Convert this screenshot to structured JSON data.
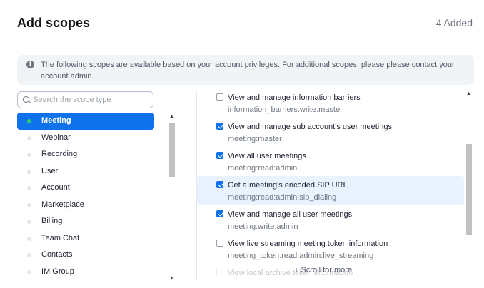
{
  "header": {
    "title": "Add scopes",
    "added_count": "4 Added"
  },
  "notice": {
    "icon": "info-icon",
    "text": "The following scopes are available based on your account privileges. For additional scopes, please please contact your account admin."
  },
  "search": {
    "placeholder": "Search the scope type",
    "value": ""
  },
  "categories": [
    {
      "label": "Meeting",
      "active": true
    },
    {
      "label": "Webinar",
      "active": false
    },
    {
      "label": "Recording",
      "active": false
    },
    {
      "label": "User",
      "active": false
    },
    {
      "label": "Account",
      "active": false
    },
    {
      "label": "Marketplace",
      "active": false
    },
    {
      "label": "Billing",
      "active": false
    },
    {
      "label": "Team Chat",
      "active": false
    },
    {
      "label": "Contacts",
      "active": false
    },
    {
      "label": "IM Group",
      "active": false
    }
  ],
  "scopes": [
    {
      "name": "View and manage information barriers",
      "code": "information_barriers:write:master",
      "checked": false
    },
    {
      "name": "View and manage sub account's user meetings",
      "code": "meeting:master",
      "checked": true
    },
    {
      "name": "View all user meetings",
      "code": "meeting:read:admin",
      "checked": true
    },
    {
      "name": "Get a meeting's encoded SIP URI",
      "code": "meeting:read:admin:sip_dialing",
      "checked": true,
      "highlight": true
    },
    {
      "name": "View and manage all user meetings",
      "code": "meeting:write:admin",
      "checked": true
    },
    {
      "name": "View live streaming meeting token information",
      "code": "meeting_token:read:admin:live_streaming",
      "checked": false
    },
    {
      "name": "View local archive token information",
      "code": "",
      "checked": false,
      "faded": true
    }
  ],
  "scroll_more": "↓ Scroll for more",
  "colors": {
    "accent": "#0e72ed",
    "active_dot": "#2ecc71",
    "highlight_bg": "#e8f3ff"
  }
}
